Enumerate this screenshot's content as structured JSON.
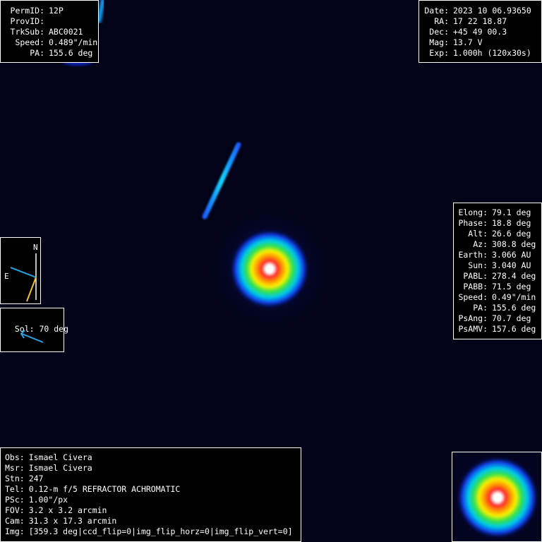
{
  "top_left": [
    {
      "label": "PermID:",
      "value": "12P"
    },
    {
      "label": "ProvID:",
      "value": ""
    },
    {
      "label": "TrkSub:",
      "value": "ABC0021"
    },
    {
      "label": "Speed:",
      "value": "0.489\"/min"
    },
    {
      "label": "PA:",
      "value": "155.6 deg"
    }
  ],
  "top_right": [
    {
      "label": "Date:",
      "value": "2023 10 06.93650"
    },
    {
      "label": "RA:",
      "value": "17 22 18.87"
    },
    {
      "label": "Dec:",
      "value": "+45 49 00.3"
    },
    {
      "label": "Mag:",
      "value": "13.7 V"
    },
    {
      "label": "Exp:",
      "value": "1.000h (120x30s)"
    }
  ],
  "mid_right": [
    {
      "label": "Elong:",
      "value": "79.1 deg"
    },
    {
      "label": "Phase:",
      "value": "18.8 deg"
    },
    {
      "label": "Alt:",
      "value": "26.6 deg"
    },
    {
      "label": "Az:",
      "value": "308.8 deg"
    },
    {
      "label": "Earth:",
      "value": "3.066 AU"
    },
    {
      "label": "Sun:",
      "value": "3.040 AU"
    },
    {
      "label": "PABL:",
      "value": "278.4 deg"
    },
    {
      "label": "PABB:",
      "value": "71.5 deg"
    },
    {
      "label": "Speed:",
      "value": "0.49\"/min"
    },
    {
      "label": "PA:",
      "value": "155.6 deg"
    },
    {
      "label": "PsAng:",
      "value": "70.7 deg"
    },
    {
      "label": "PsAMV:",
      "value": "157.6 deg"
    }
  ],
  "bottom_left": [
    {
      "label": "Obs:",
      "value": "Ismael Civera"
    },
    {
      "label": "Msr:",
      "value": "Ismael Civera"
    },
    {
      "label": "Stn:",
      "value": "247"
    },
    {
      "label": "Tel:",
      "value": "0.12-m f/5 REFRACTOR ACHROMATIC"
    },
    {
      "label": "PSc:",
      "value": "1.00\"/px"
    },
    {
      "label": "FOV:",
      "value": "3.2 x 3.2 arcmin"
    },
    {
      "label": "Cam:",
      "value": "31.3 x 17.3 arcmin"
    },
    {
      "label": "Img:",
      "value": "[359.3 deg|ccd_flip=0|img_flip_horz=0|img_flip_vert=0]"
    }
  ],
  "compass": {
    "north": "N",
    "east": "E"
  },
  "sol": {
    "text": "Sol: 70 deg"
  },
  "colors": {
    "background": "#020318",
    "panel": "#000000",
    "panel_border": "#ffffff",
    "compass_e_line": "#29a3e6",
    "compass_n_line": "#ffffff",
    "compass_pa_line": "#f2c12e",
    "sol_arrow": "#29a3e6"
  }
}
